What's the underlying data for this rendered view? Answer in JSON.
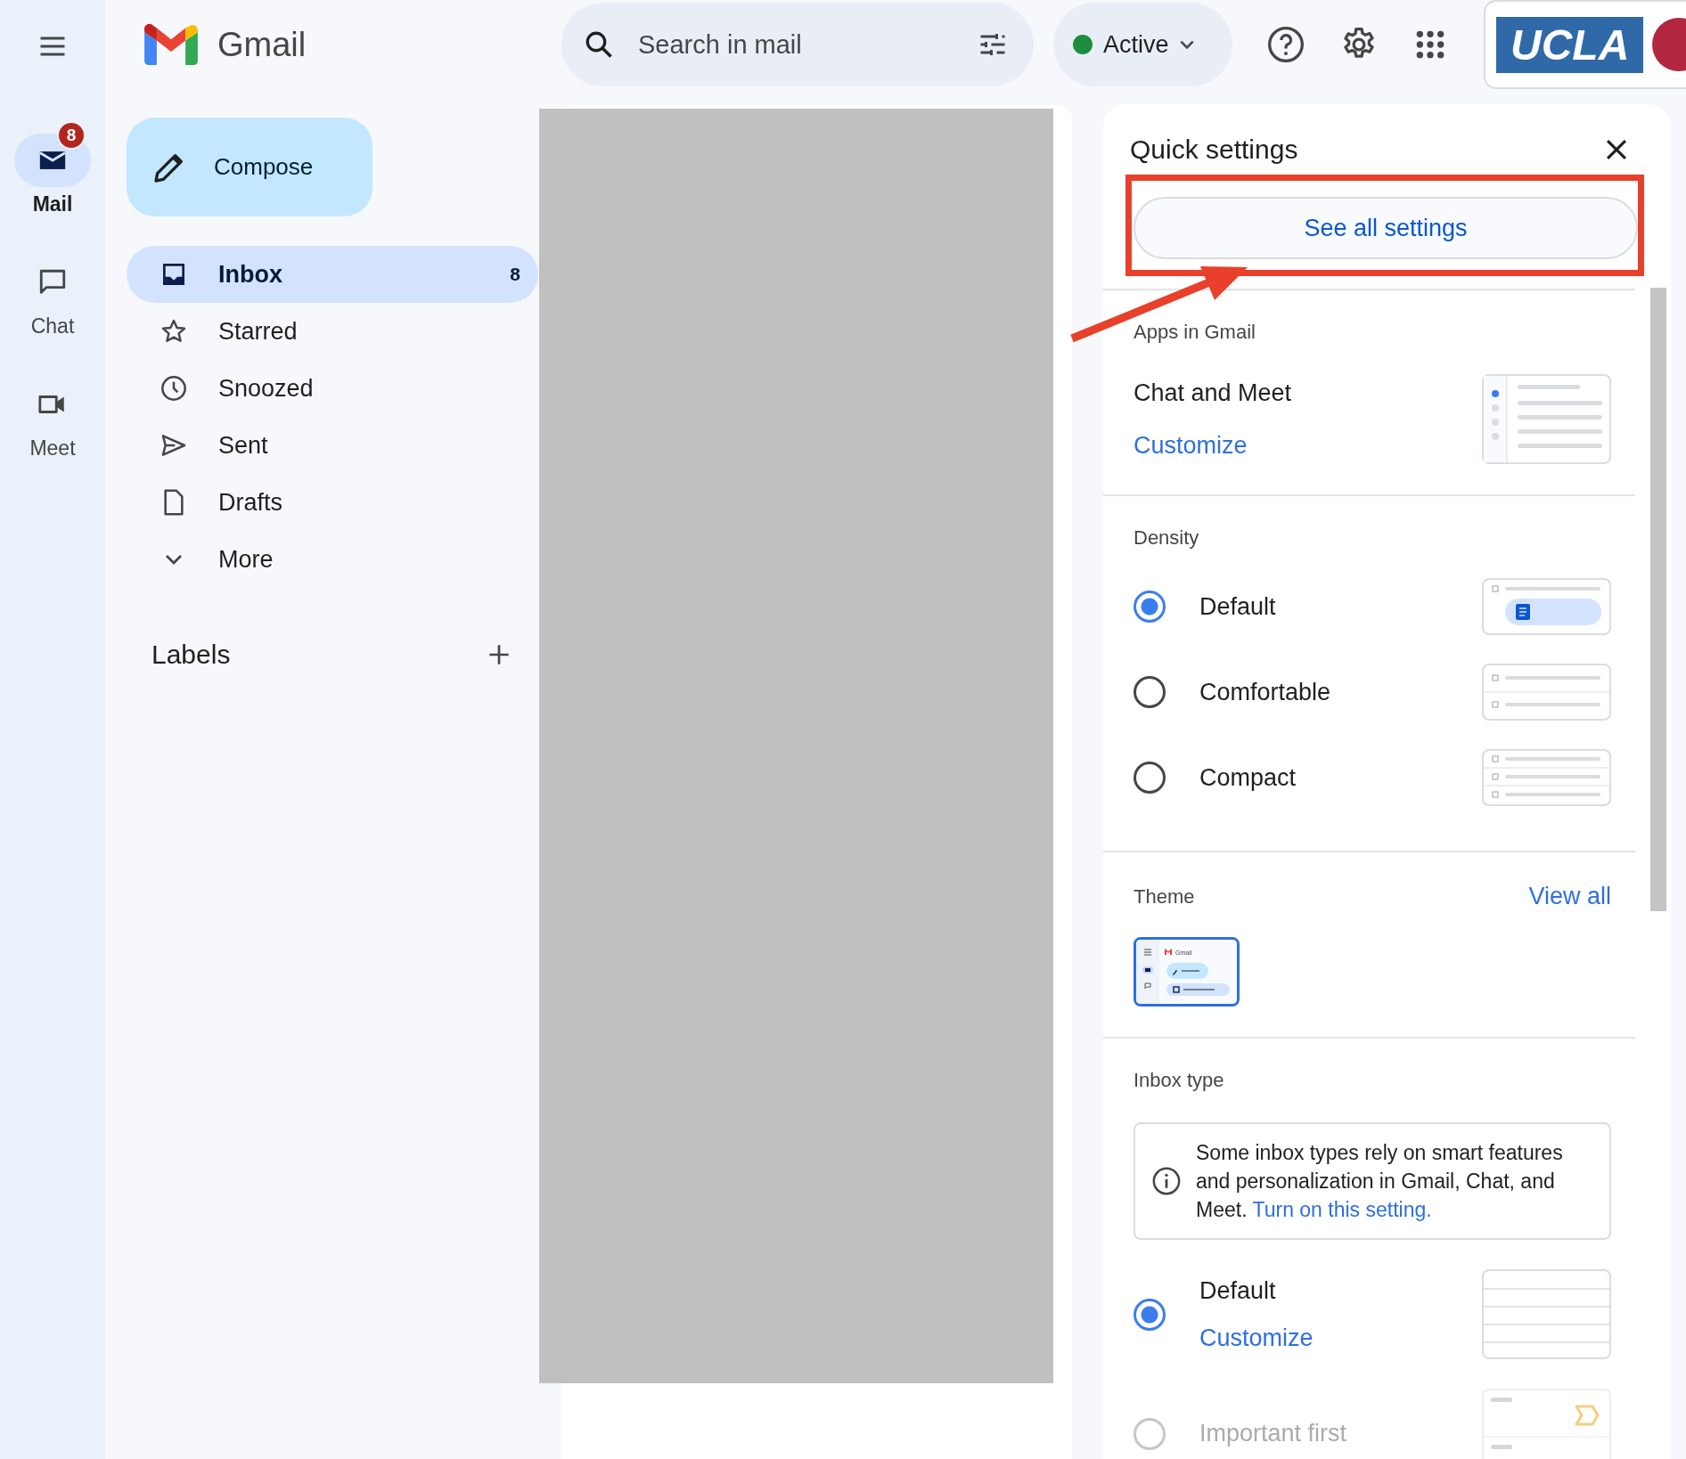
{
  "rail_items": [
    {
      "label": "Mail",
      "kind": "mail",
      "selected": true,
      "badge": "8"
    },
    {
      "label": "Chat",
      "kind": "chat",
      "selected": false
    },
    {
      "label": "Meet",
      "kind": "meet",
      "selected": false
    }
  ],
  "header": {
    "product": "Gmail",
    "search": {
      "placeholder": "Search in mail"
    },
    "status": "Active",
    "org_logo": "UCLA"
  },
  "compose": "Compose",
  "folders": [
    {
      "label": "Inbox",
      "kind": "inbox",
      "selected": true,
      "count": "8"
    },
    {
      "label": "Starred",
      "kind": "star",
      "selected": false
    },
    {
      "label": "Snoozed",
      "kind": "clock",
      "selected": false
    },
    {
      "label": "Sent",
      "kind": "sent",
      "selected": false
    },
    {
      "label": "Drafts",
      "kind": "draft",
      "selected": false
    },
    {
      "label": "More",
      "kind": "more",
      "selected": false
    }
  ],
  "labels": {
    "title": "Labels"
  },
  "quick_settings": {
    "title": "Quick settings",
    "see_all": "See all settings",
    "apps": {
      "heading": "Apps in Gmail",
      "label": "Chat and Meet",
      "link": "Customize"
    },
    "density": {
      "heading": "Density",
      "options": [
        {
          "label": "Default",
          "kind": "default",
          "selected": true
        },
        {
          "label": "Comfortable",
          "kind": "comfortable",
          "selected": false
        },
        {
          "label": "Compact",
          "kind": "compact",
          "selected": false
        }
      ]
    },
    "theme": {
      "heading": "Theme",
      "link": "View all",
      "preview_text": "Gmail",
      "selected": true
    },
    "inbox_type": {
      "heading": "Inbox type",
      "notice": "Some inbox types rely on smart features and personalization in Gmail, Chat, and Meet.",
      "notice_link": "Turn on this setting.",
      "options": [
        {
          "label": "Default",
          "kind": "default",
          "link": "Customize",
          "selected": true,
          "disabled": false
        },
        {
          "label": "Important first",
          "kind": "important",
          "selected": false,
          "disabled": true
        }
      ]
    }
  }
}
